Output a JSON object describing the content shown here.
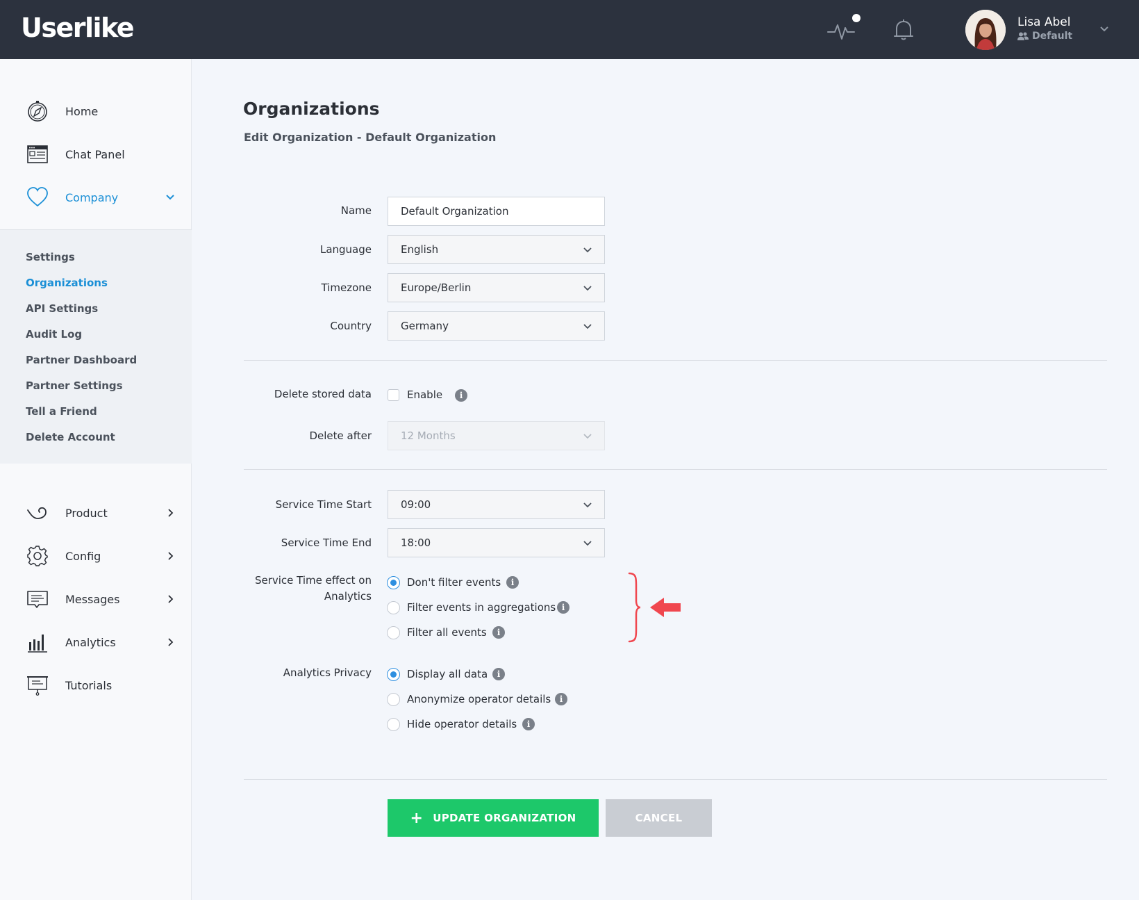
{
  "header": {
    "logo_text": "Userlike",
    "user_name": "Lisa Abel",
    "user_role": "Default",
    "icons": [
      "activity-pulse-icon",
      "bell-icon",
      "avatar",
      "chevron-down-icon"
    ]
  },
  "sidebar": {
    "top_items": [
      {
        "label": "Home",
        "icon": "compass-icon"
      },
      {
        "label": "Chat Panel",
        "icon": "chat-panel-icon"
      },
      {
        "label": "Company",
        "icon": "heart-icon",
        "active": true
      }
    ],
    "sub_items": [
      {
        "label": "Settings"
      },
      {
        "label": "Organizations",
        "active": true
      },
      {
        "label": "API Settings"
      },
      {
        "label": "Audit Log"
      },
      {
        "label": "Partner Dashboard"
      },
      {
        "label": "Partner Settings"
      },
      {
        "label": "Tell a Friend"
      },
      {
        "label": "Delete Account"
      }
    ],
    "bottom_items": [
      {
        "label": "Product",
        "icon": "product-icon"
      },
      {
        "label": "Config",
        "icon": "gear-icon"
      },
      {
        "label": "Messages",
        "icon": "message-icon"
      },
      {
        "label": "Analytics",
        "icon": "bar-chart-icon"
      },
      {
        "label": "Tutorials",
        "icon": "presentation-icon"
      }
    ]
  },
  "main": {
    "title": "Organizations",
    "subtitle": "Edit Organization - Default Organization",
    "fields": {
      "name": {
        "label": "Name",
        "value": "Default Organization"
      },
      "language": {
        "label": "Language",
        "value": "English"
      },
      "timezone": {
        "label": "Timezone",
        "value": "Europe/Berlin"
      },
      "country": {
        "label": "Country",
        "value": "Germany"
      },
      "delete_stored_data": {
        "label": "Delete stored data",
        "option": "Enable",
        "checked": false
      },
      "delete_after": {
        "label": "Delete after",
        "value": "12 Months",
        "disabled": true
      },
      "service_time_start": {
        "label": "Service Time Start",
        "value": "09:00"
      },
      "service_time_end": {
        "label": "Service Time End",
        "value": "18:00"
      },
      "service_time_effect": {
        "label_line1": "Service Time effect on",
        "label_line2": "Analytics",
        "options": [
          {
            "label": "Don't filter events",
            "checked": true
          },
          {
            "label": "Filter events in aggregations",
            "checked": false
          },
          {
            "label": "Filter all events",
            "checked": false
          }
        ]
      },
      "analytics_privacy": {
        "label": "Analytics Privacy",
        "options": [
          {
            "label": "Display all data",
            "checked": true
          },
          {
            "label": "Anonymize operator details",
            "checked": false
          },
          {
            "label": "Hide operator details",
            "checked": false
          }
        ]
      }
    },
    "info_glyph": "i",
    "buttons": {
      "update_icon": "+",
      "update_label": "UPDATE ORGANIZATION",
      "cancel_label": "CANCEL"
    },
    "colors": {
      "accent_blue": "#1a8fd6",
      "radio_blue": "#2e8fe0",
      "update_green": "#1dc86a",
      "annotation_red": "#f0474f"
    }
  }
}
